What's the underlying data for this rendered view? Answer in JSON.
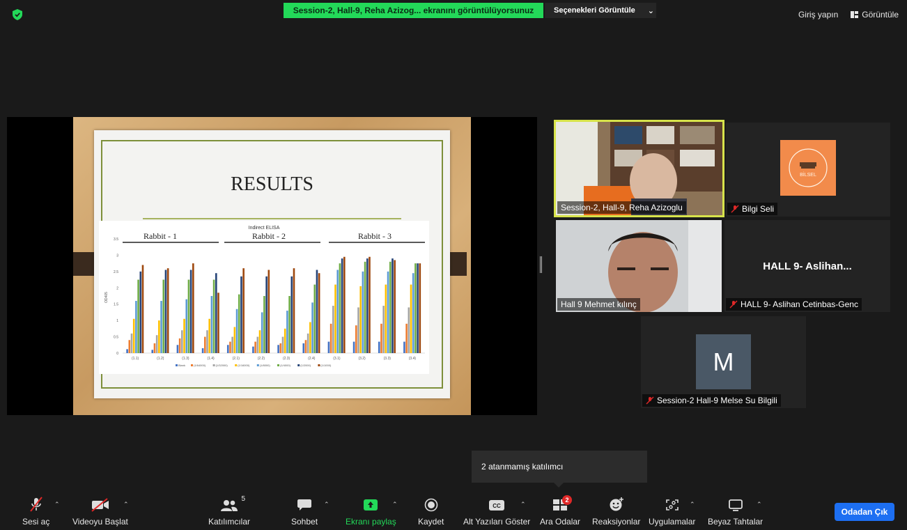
{
  "top": {
    "share_banner": "Session-2, Hall-9, Reha Azizog... ekranını görüntülüyorsunuz",
    "view_options": "Seçenekleri Görüntüle",
    "sign_in": "Giriş yapın",
    "view": "Görüntüle"
  },
  "slide": {
    "title": "RESULTS",
    "chart_title": "Indirect ELISA",
    "groups": [
      "Rabbit - 1",
      "Rabbit - 2",
      "Rabbit - 3"
    ],
    "y_label": "OD405"
  },
  "chart_data": {
    "type": "bar",
    "title": "Indirect ELISA",
    "ylabel": "OD405",
    "ylim": [
      0,
      3.5
    ],
    "y_ticks": [
      "0",
      "0.5",
      "1",
      "1.5",
      "2",
      "2.5",
      "3",
      "3.5"
    ],
    "categories": [
      "(1.1)",
      "(1.2)",
      "(1.3)",
      "(1.4)",
      "(2.1)",
      "(2.2)",
      "(2.3)",
      "(2.4)",
      "(3.1)",
      "(3.2)",
      "(3.3)",
      "(3.4)"
    ],
    "series": [
      {
        "name": "Blank",
        "color": "#4472c4",
        "values": [
          0.12,
          0.1,
          0.25,
          0.15,
          0.25,
          0.2,
          0.25,
          0.3,
          0.35,
          0.35,
          0.35,
          0.35
        ]
      },
      {
        "name": "(1/64000)",
        "color": "#ed7d31",
        "values": [
          0.4,
          0.3,
          0.45,
          0.5,
          0.35,
          0.35,
          0.3,
          0.4,
          0.9,
          0.85,
          0.9,
          0.9
        ]
      },
      {
        "name": "(1/32000)",
        "color": "#a5a5a5",
        "values": [
          0.6,
          0.55,
          0.7,
          0.7,
          0.5,
          0.5,
          0.5,
          0.6,
          1.45,
          1.4,
          1.45,
          1.4
        ]
      },
      {
        "name": "(1/16000)",
        "color": "#ffc000",
        "values": [
          1.05,
          1.0,
          1.05,
          1.05,
          0.8,
          0.7,
          0.75,
          0.95,
          2.1,
          2.05,
          2.1,
          2.1
        ]
      },
      {
        "name": "(1/8000)",
        "color": "#5b9bd5",
        "values": [
          1.6,
          1.6,
          1.65,
          1.75,
          1.35,
          1.25,
          1.3,
          1.55,
          2.55,
          2.5,
          2.5,
          2.45
        ]
      },
      {
        "name": "(1/4000)",
        "color": "#70ad47",
        "values": [
          2.25,
          2.25,
          2.25,
          2.25,
          1.8,
          1.75,
          1.75,
          2.1,
          2.75,
          2.8,
          2.8,
          2.75
        ]
      },
      {
        "name": "(1/2000)",
        "color": "#264478",
        "values": [
          2.5,
          2.55,
          2.55,
          2.45,
          2.35,
          2.35,
          2.35,
          2.55,
          2.9,
          2.9,
          2.9,
          2.75
        ]
      },
      {
        "name": "(1/1000)",
        "color": "#9e480e",
        "values": [
          2.7,
          2.6,
          2.75,
          1.85,
          2.6,
          2.55,
          2.6,
          2.45,
          2.95,
          2.95,
          2.85,
          2.75
        ]
      }
    ]
  },
  "gallery": {
    "t1_name": "Session-2, Hall-9, Reha Azizoglu",
    "t2_name": "Bilgi Seli",
    "t2_logo": "BİLSEL",
    "t3_name": "Hall 9 Mehmet kılınç",
    "t4_big": "HALL 9- Aslihan...",
    "t4_name": "HALL 9- Aslihan Cetinbas-Genc",
    "t5_avatar": "M",
    "t5_name": "Session-2 Hall-9 Melse Su Bilgili"
  },
  "tooltip": "2 atanmamış katılımcı",
  "toolbar": {
    "unmute": "Sesi aç",
    "start_video": "Videoyu Başlat",
    "participants": "Katılımcılar",
    "participants_count": "5",
    "chat": "Sohbet",
    "share": "Ekranı paylaş",
    "record": "Kaydet",
    "captions": "Alt Yazıları Göster",
    "cc_icon": "CC",
    "breakout": "Ara Odalar",
    "breakout_badge": "2",
    "reactions": "Reaksiyonlar",
    "apps": "Uygulamalar",
    "whiteboards": "Beyaz Tahtalar",
    "leave": "Odadan Çık"
  }
}
